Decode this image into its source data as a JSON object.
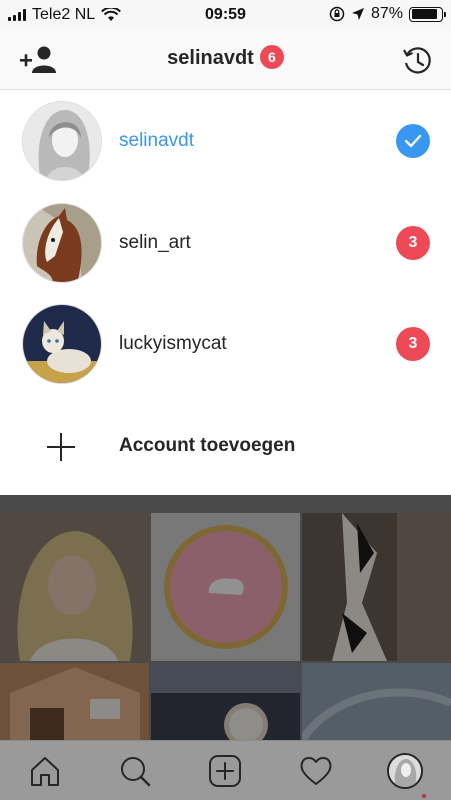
{
  "status_bar": {
    "carrier": "Tele2 NL",
    "time": "09:59",
    "battery": "87%",
    "battery_level": 0.87
  },
  "header": {
    "title": "selinavdt",
    "notification_count": "6"
  },
  "accounts": [
    {
      "username": "selinavdt",
      "status": "active",
      "icon": "checkmark-icon",
      "badge": ""
    },
    {
      "username": "selin_art",
      "status": "inactive",
      "icon": "",
      "badge": "3"
    },
    {
      "username": "luckyismycat",
      "status": "inactive",
      "icon": "",
      "badge": "3"
    }
  ],
  "add_account": {
    "label": "Account toevoegen",
    "icon": "plus-icon"
  },
  "tabbar": {
    "items": [
      "home-icon",
      "search-icon",
      "new-post-icon",
      "activity-heart-icon",
      "profile-avatar"
    ]
  },
  "colors": {
    "accent_blue": "#3897f0",
    "badge_red": "#ed4956",
    "text": "#262626"
  }
}
